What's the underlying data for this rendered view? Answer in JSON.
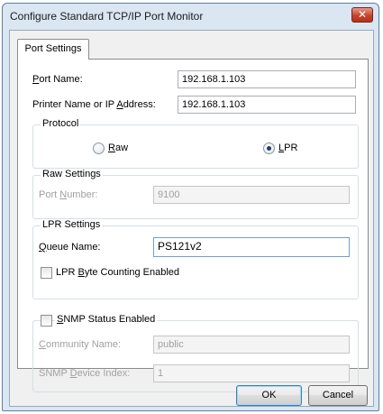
{
  "window": {
    "title": "Configure Standard TCP/IP Port Monitor",
    "close_glyph": "✕"
  },
  "tabs": [
    {
      "label": "Port Settings"
    }
  ],
  "port_name": {
    "label_pre": "",
    "label_key": "P",
    "label_post": "ort Name:",
    "value": "192.168.1.103"
  },
  "printer_address": {
    "label_pre": "Printer Name or IP ",
    "label_key": "A",
    "label_post": "ddress:",
    "value": "192.168.1.103"
  },
  "protocol": {
    "legend": "Protocol",
    "raw": {
      "label_pre": "",
      "label_key": "R",
      "label_post": "aw",
      "selected": false
    },
    "lpr": {
      "label_pre": "",
      "label_key": "L",
      "label_post": "PR",
      "selected": true
    }
  },
  "raw_settings": {
    "legend": "Raw Settings",
    "port_number": {
      "label_pre": "Port ",
      "label_key": "N",
      "label_post": "umber:",
      "value": "9100"
    }
  },
  "lpr_settings": {
    "legend": "LPR Settings",
    "queue_name": {
      "label_pre": "",
      "label_key": "Q",
      "label_post": "ueue Name:",
      "value": "PS121v2"
    },
    "byte_counting": {
      "label_pre": "LPR ",
      "label_key": "B",
      "label_post": "yte Counting Enabled",
      "checked": false
    }
  },
  "snmp": {
    "enabled": {
      "label_pre": "",
      "label_key": "S",
      "label_post": "NMP Status Enabled",
      "checked": false
    },
    "community": {
      "label_pre": "",
      "label_key": "C",
      "label_post": "ommunity Name:",
      "value": "public"
    },
    "device_index": {
      "label_pre": "SNMP ",
      "label_key": "D",
      "label_post": "evice Index:",
      "value": "1"
    }
  },
  "buttons": {
    "ok": "OK",
    "cancel": "Cancel"
  }
}
